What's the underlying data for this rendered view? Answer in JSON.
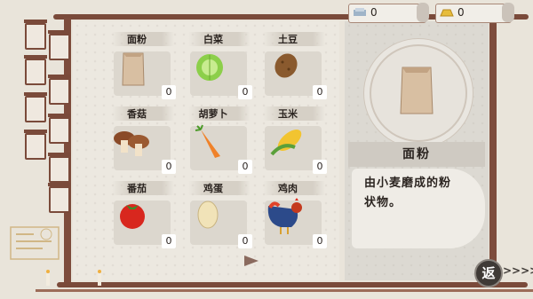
{
  "currency": {
    "left_value": "0",
    "right_value": "0",
    "left_icon": "tile-icon",
    "right_icon": "gold-ingot-icon"
  },
  "items": [
    {
      "name": "面粉",
      "count": "0",
      "icon": "flour-bag-icon"
    },
    {
      "name": "白菜",
      "count": "0",
      "icon": "cabbage-icon"
    },
    {
      "name": "土豆",
      "count": "0",
      "icon": "potato-icon"
    },
    {
      "name": "香菇",
      "count": "0",
      "icon": "mushroom-icon"
    },
    {
      "name": "胡萝卜",
      "count": "0",
      "icon": "carrot-icon"
    },
    {
      "name": "玉米",
      "count": "0",
      "icon": "corn-icon"
    },
    {
      "name": "番茄",
      "count": "0",
      "icon": "tomato-icon"
    },
    {
      "name": "鸡蛋",
      "count": "0",
      "icon": "egg-icon"
    },
    {
      "name": "鸡肉",
      "count": "0",
      "icon": "rooster-icon"
    }
  ],
  "detail": {
    "title": "面粉",
    "description_line1": "由小麦磨成的粉",
    "description_line2": "状物。",
    "icon": "flour-bag-icon"
  },
  "nav": {
    "back_label": "返",
    "more_label": ">>>>"
  },
  "colors": {
    "frame": "#7a4a3a",
    "count_bg": "#ffffff"
  }
}
